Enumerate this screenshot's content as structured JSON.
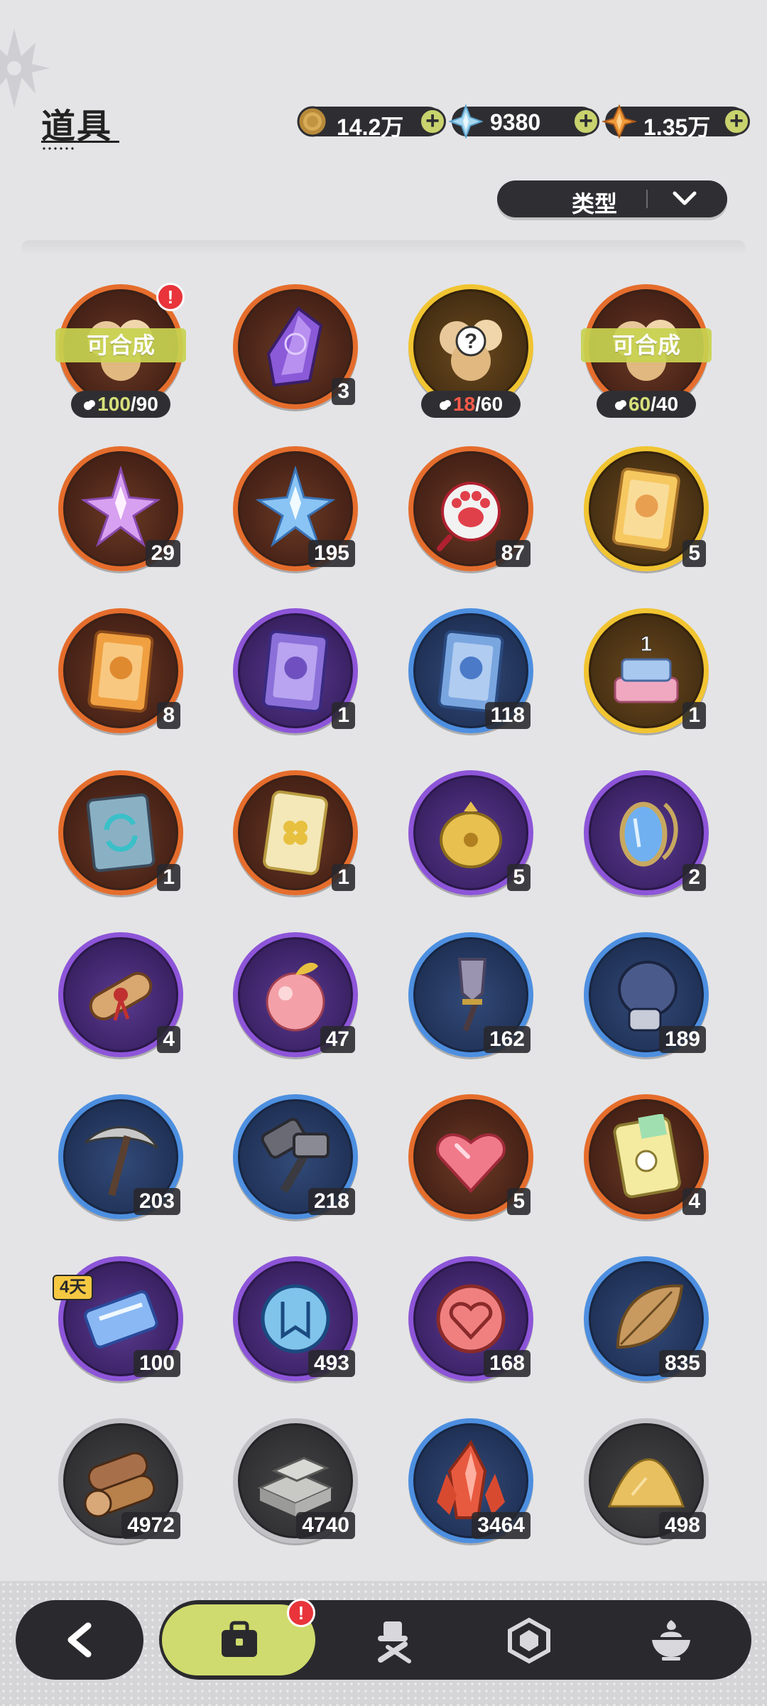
{
  "header": {
    "title": "道具"
  },
  "currencies": [
    {
      "icon": "gold-coin-icon",
      "value": "14.2万"
    },
    {
      "icon": "crystal-gem-icon",
      "value": "9380"
    },
    {
      "icon": "star-shard-icon",
      "value": "1.35万"
    }
  ],
  "filter": {
    "label": "类型"
  },
  "items": [
    {
      "icon": "furry-fragment-icon",
      "rarity": "orange",
      "synth": "可合成",
      "frag_have": "100",
      "frag_need": "/90",
      "frag_ok": true,
      "alert": "!"
    },
    {
      "icon": "purple-crystal-icon",
      "rarity": "orange",
      "count": "3"
    },
    {
      "icon": "mystery-fragment-icon",
      "rarity": "gold",
      "frag_have": "18",
      "frag_need": "/60",
      "frag_ok": false
    },
    {
      "icon": "furry-fragment-icon",
      "rarity": "orange",
      "synth": "可合成",
      "frag_have": "60",
      "frag_need": "/40",
      "frag_ok": true
    },
    {
      "icon": "pink-star-crystal-icon",
      "rarity": "orange",
      "count": "29"
    },
    {
      "icon": "blue-star-crystal-icon",
      "rarity": "orange",
      "count": "195"
    },
    {
      "icon": "paw-charm-icon",
      "rarity": "orange",
      "count": "87"
    },
    {
      "icon": "golden-card-icon",
      "rarity": "gold",
      "count": "5"
    },
    {
      "icon": "orange-card-icon",
      "rarity": "orange",
      "count": "8"
    },
    {
      "icon": "purple-card-icon",
      "rarity": "purple",
      "count": "1"
    },
    {
      "icon": "blue-card-icon",
      "rarity": "blue",
      "count": "118"
    },
    {
      "icon": "birthday-cake-icon",
      "rarity": "gold",
      "count": "1"
    },
    {
      "icon": "refresh-card-icon",
      "rarity": "orange",
      "count": "1"
    },
    {
      "icon": "clover-ticket-icon",
      "rarity": "orange",
      "count": "1"
    },
    {
      "icon": "golden-pouch-icon",
      "rarity": "purple",
      "count": "5"
    },
    {
      "icon": "magic-mirror-icon",
      "rarity": "purple",
      "count": "2"
    },
    {
      "icon": "scroll-icon",
      "rarity": "purple",
      "count": "4"
    },
    {
      "icon": "peach-fruit-icon",
      "rarity": "purple",
      "count": "47"
    },
    {
      "icon": "shovel-icon",
      "rarity": "blue",
      "count": "162"
    },
    {
      "icon": "boxing-glove-icon",
      "rarity": "blue",
      "count": "189"
    },
    {
      "icon": "pickaxe-icon",
      "rarity": "blue",
      "count": "203"
    },
    {
      "icon": "hammer-icon",
      "rarity": "blue",
      "count": "218"
    },
    {
      "icon": "ruby-heart-icon",
      "rarity": "orange",
      "count": "5"
    },
    {
      "icon": "rainbow-ticket-icon",
      "rarity": "orange",
      "count": "4"
    },
    {
      "icon": "blue-ticket-icon",
      "rarity": "purple",
      "count": "100",
      "days": "4天"
    },
    {
      "icon": "blue-medal-icon",
      "rarity": "purple",
      "count": "493"
    },
    {
      "icon": "heart-medal-icon",
      "rarity": "purple",
      "count": "168"
    },
    {
      "icon": "leaf-icon",
      "rarity": "blue",
      "count": "835"
    },
    {
      "icon": "wood-logs-icon",
      "rarity": "gray",
      "count": "4972"
    },
    {
      "icon": "stone-bricks-icon",
      "rarity": "gray",
      "count": "4740"
    },
    {
      "icon": "red-crystal-icon",
      "rarity": "blue",
      "count": "3464"
    },
    {
      "icon": "sand-pile-icon",
      "rarity": "gray",
      "count": "498"
    }
  ],
  "bottom_nav": {
    "tabs": [
      {
        "icon": "briefcase-icon",
        "active": true,
        "alert": "!"
      },
      {
        "icon": "hat-tools-icon"
      },
      {
        "icon": "hexagon-gem-icon"
      },
      {
        "icon": "dessert-bowl-icon"
      }
    ]
  }
}
